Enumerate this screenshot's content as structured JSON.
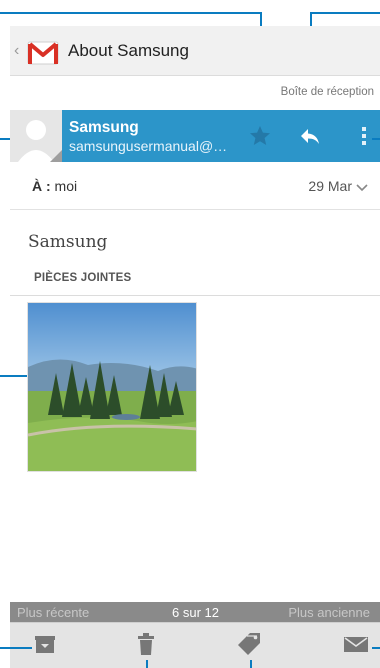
{
  "actionbar": {
    "title": "About Samsung"
  },
  "mailbox": {
    "label": "Boîte de réception"
  },
  "sender": {
    "name": "Samsung",
    "email": "samsungusermanual@…"
  },
  "message": {
    "to_label": "À :",
    "to_value": " moi",
    "date": "29 Mar",
    "subject": "Samsung",
    "attachments_header": "PIÈCES JOINTES"
  },
  "pager": {
    "newer": "Plus récente",
    "count": "6 sur 12",
    "older": "Plus ancienne"
  },
  "icons": {
    "app": "gmail-icon",
    "star": "star-icon",
    "reply": "reply-icon",
    "overflow": "overflow-menu-icon",
    "archive": "archive-icon",
    "delete": "trash-icon",
    "label": "label-icon",
    "mark_unread": "mark-unread-icon"
  },
  "colors": {
    "accent": "#2c95c9",
    "callout": "#0a7cc0",
    "gmail_red": "#d93025"
  }
}
